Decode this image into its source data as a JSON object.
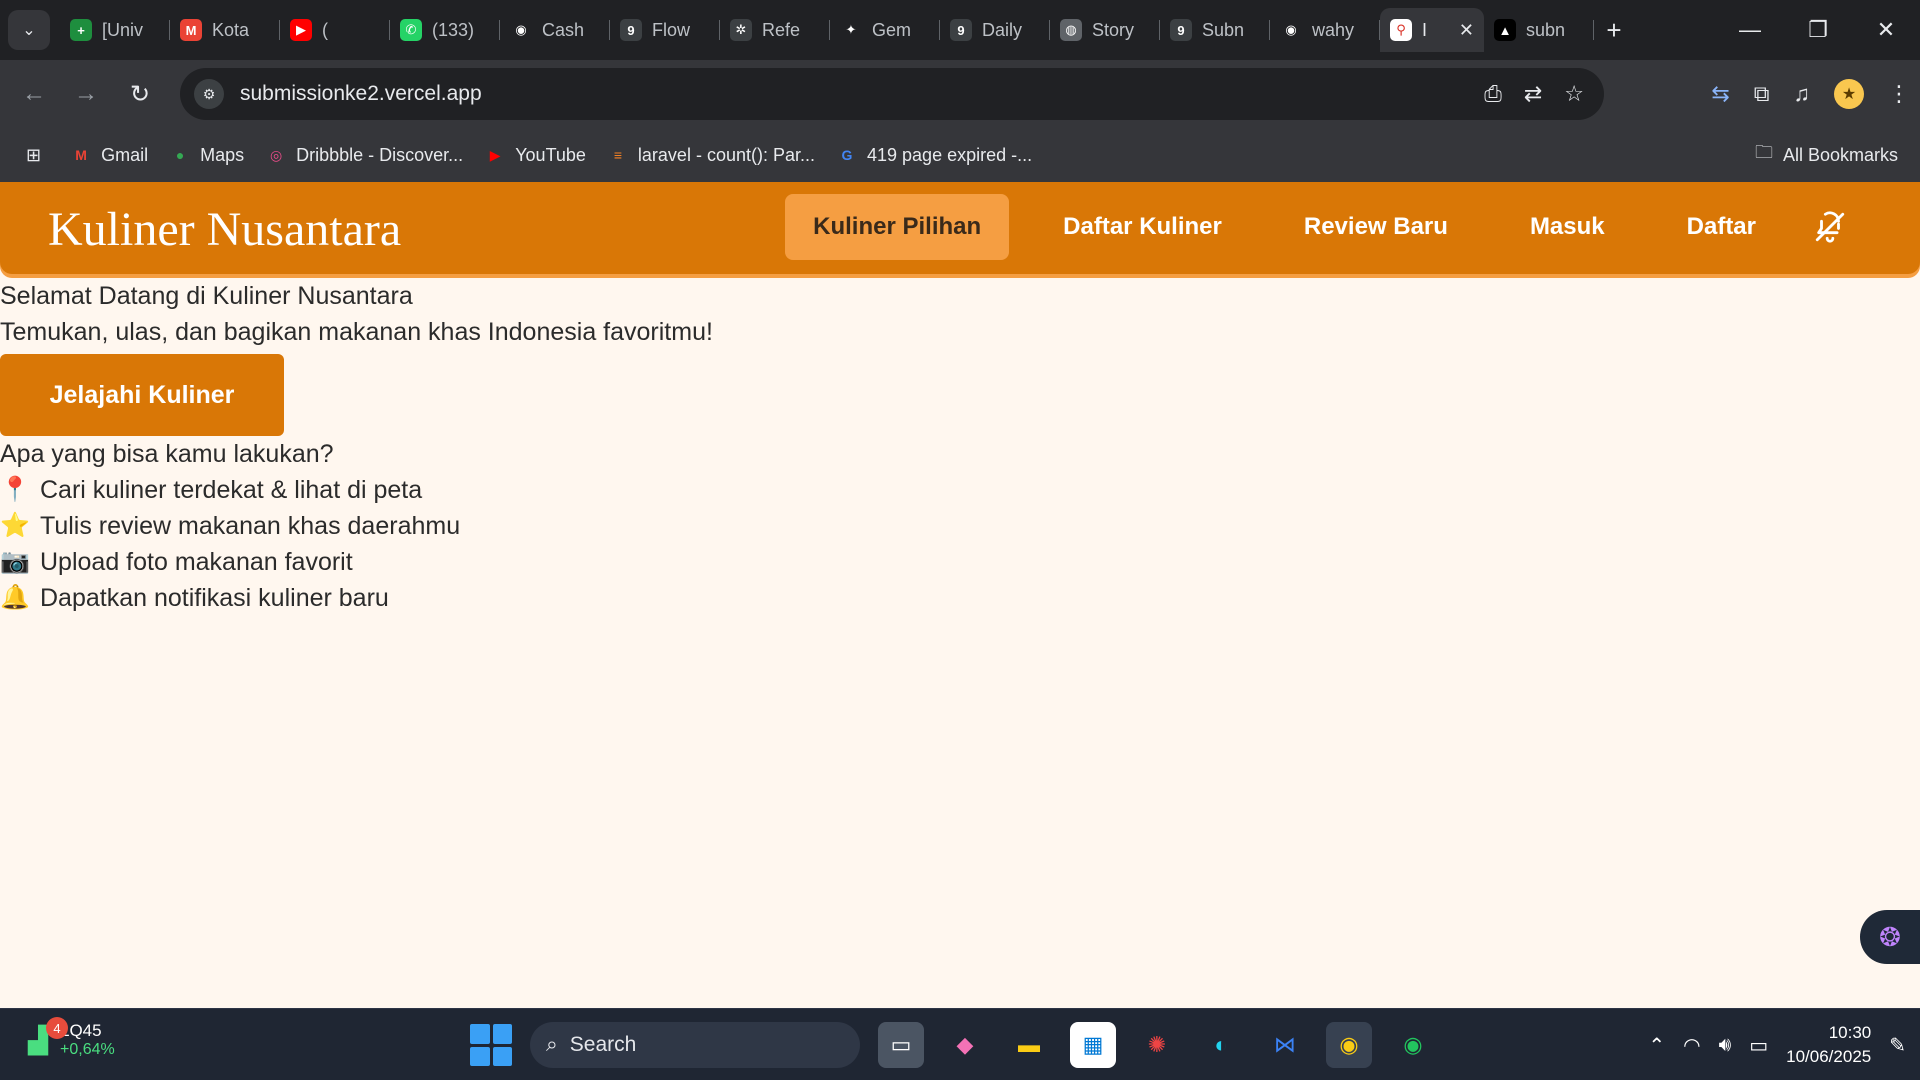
{
  "browser": {
    "tabs": [
      {
        "title": "[Univ",
        "favicon": "sheets-icon",
        "color": "#1e8e3e",
        "glyph": "+"
      },
      {
        "title": "Kota",
        "favicon": "gmail-icon",
        "color": "#ea4335",
        "glyph": "M"
      },
      {
        "title": "(",
        "favicon": "youtube-icon",
        "color": "#ff0000",
        "glyph": "▶"
      },
      {
        "title": "(133)",
        "favicon": "whatsapp-icon",
        "color": "#25d366",
        "glyph": "✆"
      },
      {
        "title": "Cash",
        "favicon": "github-icon",
        "color": "#202124",
        "glyph": "◉"
      },
      {
        "title": "Flow",
        "favicon": "stats-icon",
        "color": "#3c4043",
        "glyph": "9"
      },
      {
        "title": "Refe",
        "favicon": "openai-icon",
        "color": "#3c4043",
        "glyph": "✲"
      },
      {
        "title": "Gem",
        "favicon": "gemini-icon",
        "color": "#202124",
        "glyph": "✦"
      },
      {
        "title": "Daily",
        "favicon": "stats-icon",
        "color": "#3c4043",
        "glyph": "9"
      },
      {
        "title": "Story",
        "favicon": "globe-icon",
        "color": "#5f6368",
        "glyph": "◍"
      },
      {
        "title": "Subn",
        "favicon": "stats-icon",
        "color": "#3c4043",
        "glyph": "9"
      },
      {
        "title": "wahy",
        "favicon": "github-icon",
        "color": "#202124",
        "glyph": "◉"
      }
    ],
    "active_tab": {
      "title": "I",
      "favicon": "map-pin-icon"
    },
    "last_tab": {
      "title": "subn",
      "favicon": "vercel-icon"
    },
    "url": "submissionke2.vercel.app",
    "bookmarks": [
      {
        "label": "Gmail",
        "icon": "gmail-icon",
        "glyph": "M",
        "color": "#ea4335"
      },
      {
        "label": "Maps",
        "icon": "maps-icon",
        "glyph": "●",
        "color": "#34a853"
      },
      {
        "label": "Dribbble - Discover...",
        "icon": "dribbble-icon",
        "glyph": "◎",
        "color": "#ea4c89"
      },
      {
        "label": "YouTube",
        "icon": "youtube-icon",
        "glyph": "▶",
        "color": "#ff0000"
      },
      {
        "label": "laravel - count(): Par...",
        "icon": "stackoverflow-icon",
        "glyph": "≡",
        "color": "#f48024"
      },
      {
        "label": "419 page expired -...",
        "icon": "google-icon",
        "glyph": "G",
        "color": "#4285f4"
      }
    ],
    "all_bookmarks": "All Bookmarks"
  },
  "site": {
    "brand": "Kuliner Nusantara",
    "nav": [
      "Kuliner Pilihan",
      "Daftar Kuliner",
      "Review Baru",
      "Masuk",
      "Daftar"
    ],
    "hero_title": "Selamat Datang di Kuliner Nusantara",
    "hero_subtitle": "Temukan, ulas, dan bagikan makanan khas Indonesia favoritmu!",
    "cta": "Jelajahi Kuliner",
    "features_heading": "Apa yang bisa kamu lakukan?",
    "features": [
      {
        "emoji": "📍",
        "text": "Cari kuliner terdekat & lihat di peta"
      },
      {
        "emoji": "⭐",
        "text": "Tulis review makanan khas daerahmu"
      },
      {
        "emoji": "📷",
        "text": "Upload foto makanan favorit"
      },
      {
        "emoji": "🔔",
        "text": "Dapatkan notifikasi kuliner baru"
      }
    ],
    "accent": "#d97706"
  },
  "taskbar": {
    "stock_name": "LQ45",
    "stock_change": "+0,64%",
    "badge": "4",
    "search": "Search",
    "time": "10:30",
    "date": "10/06/2025"
  }
}
